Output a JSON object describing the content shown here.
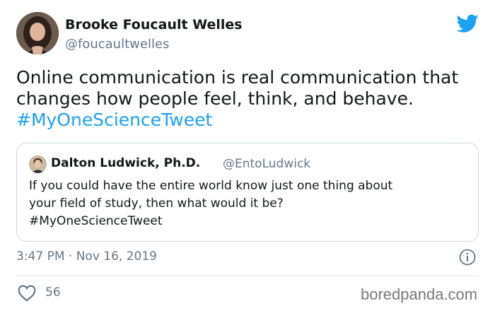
{
  "author": {
    "name": "Brooke Foucault Welles",
    "handle": "@foucaultwelles"
  },
  "tweet": {
    "lines": [
      "Online communication is real communication that",
      "changes how people feel, think, and behave."
    ],
    "hashtag": "#MyOneScienceTweet"
  },
  "quoted_tweet": {
    "name": "Dalton Ludwick, Ph.D.",
    "handle": "@EntoLudwick",
    "lines": [
      "If you could have the entire world know just one thing about",
      "your field of study, then what would it be?",
      "#MyOneScienceTweet"
    ]
  },
  "timestamp": "3:47 PM · Nov 16, 2019",
  "likes": "56",
  "watermark": "boredpanda.com",
  "icons": {
    "brand": "twitter-bird-icon",
    "info": "info-icon",
    "like": "heart-icon"
  },
  "colors": {
    "brand_blue": "#1da1f2",
    "secondary_text": "#657786",
    "border": "#ccd6dd"
  }
}
